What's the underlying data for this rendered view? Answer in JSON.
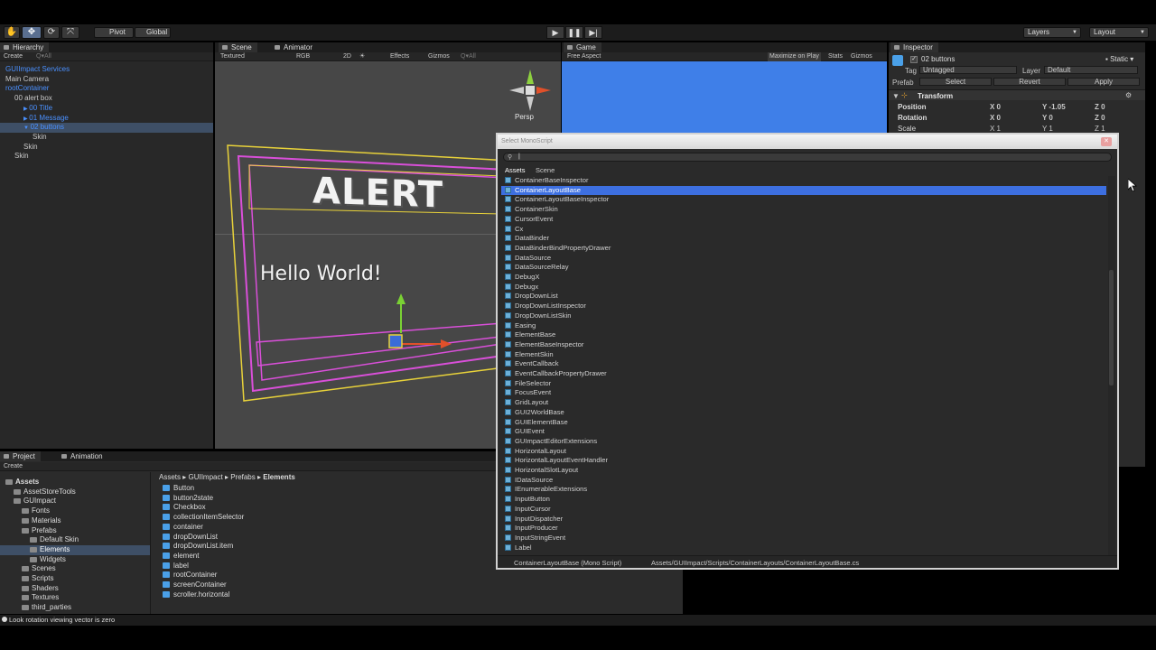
{
  "toolbar": {
    "pivot": "Pivot",
    "global": "Global",
    "layers": "Layers",
    "layout": "Layout"
  },
  "hierarchy": {
    "tab": "Hierarchy",
    "create": "Create",
    "search": "All",
    "items": [
      {
        "label": "GUIImpact Services",
        "indent": 0,
        "color": "blue"
      },
      {
        "label": "Main Camera",
        "indent": 0,
        "color": "normal"
      },
      {
        "label": "rootContainer",
        "indent": 0,
        "color": "blue"
      },
      {
        "label": "00 alert box",
        "indent": 1,
        "color": "normal"
      },
      {
        "label": "00 Title",
        "indent": 2,
        "color": "blue"
      },
      {
        "label": "01 Message",
        "indent": 2,
        "color": "blue"
      },
      {
        "label": "02 buttons",
        "indent": 2,
        "color": "blue",
        "selected": true
      },
      {
        "label": "Skin",
        "indent": 3,
        "color": "normal"
      },
      {
        "label": "Skin",
        "indent": 2,
        "color": "normal"
      },
      {
        "label": "Skin",
        "indent": 1,
        "color": "normal"
      }
    ]
  },
  "scene": {
    "tab": "Scene",
    "tab2": "Animator",
    "shading": "Textured",
    "rgb": "RGB",
    "mode2d": "2D",
    "effects": "Effects",
    "gizmos": "Gizmos",
    "search": "All",
    "persp": "Persp",
    "alert_text": "ALERT",
    "hello_text": "Hello World!"
  },
  "game": {
    "tab": "Game",
    "aspect": "Free Aspect",
    "maximize": "Maximize on Play",
    "stats": "Stats",
    "gizmos": "Gizmos"
  },
  "inspector": {
    "tab": "Inspector",
    "object_name": "02 buttons",
    "static": "Static",
    "tag_label": "Tag",
    "tag_value": "Untagged",
    "layer_label": "Layer",
    "layer_value": "Default",
    "prefab_label": "Prefab",
    "select": "Select",
    "revert": "Revert",
    "apply": "Apply",
    "transform": "Transform",
    "position": "Position",
    "rotation": "Rotation",
    "scale": "Scale",
    "pos_x": "X 0",
    "pos_y": "Y -1.05",
    "pos_z": "Z 0",
    "rot_x": "X 0",
    "rot_y": "Y 0",
    "rot_z": "Z 0",
    "scl_x": "X 1",
    "scl_y": "Y 1",
    "scl_z": "Z 1"
  },
  "project": {
    "tab": "Project",
    "tab2": "Animation",
    "create": "Create",
    "breadcrumb": [
      "Assets",
      "GUIImpact",
      "Prefabs",
      "Elements"
    ],
    "tree": [
      {
        "label": "Assets",
        "indent": 0,
        "bold": true
      },
      {
        "label": "AssetStoreTools",
        "indent": 1
      },
      {
        "label": "GUImpact",
        "indent": 1
      },
      {
        "label": "Fonts",
        "indent": 2
      },
      {
        "label": "Materials",
        "indent": 2
      },
      {
        "label": "Prefabs",
        "indent": 2
      },
      {
        "label": "Default Skin",
        "indent": 3
      },
      {
        "label": "Elements",
        "indent": 3,
        "selected": true
      },
      {
        "label": "Widgets",
        "indent": 3
      },
      {
        "label": "Scenes",
        "indent": 2
      },
      {
        "label": "Scripts",
        "indent": 2
      },
      {
        "label": "Shaders",
        "indent": 2
      },
      {
        "label": "Textures",
        "indent": 2
      },
      {
        "label": "third_parties",
        "indent": 2
      }
    ],
    "files": [
      "Button",
      "button2state",
      "Checkbox",
      "collectionItemSelector",
      "container",
      "dropDownList",
      "dropDownList.item",
      "element",
      "label",
      "rootContainer",
      "screenContainer",
      "scroller.horizontal"
    ]
  },
  "status": {
    "message": "Look rotation viewing vector is zero"
  },
  "dialog": {
    "title": "Select MonoScript",
    "search_value": "|",
    "tab_assets": "Assets",
    "tab_scene": "Scene",
    "items": [
      "ContainerBaseInspector",
      "ContainerLayoutBase",
      "ContainerLayoutBaseInspector",
      "ContainerSkin",
      "CursorEvent",
      "Cx",
      "DataBinder",
      "DataBinderBindPropertyDrawer",
      "DataSource",
      "DataSourceRelay",
      "DebugX",
      "Debugx",
      "DropDownList",
      "DropDownListInspector",
      "DropDownListSkin",
      "Easing",
      "ElementBase",
      "ElementBaseInspector",
      "ElementSkin",
      "EventCallback",
      "EventCallbackPropertyDrawer",
      "FileSelector",
      "FocusEvent",
      "GridLayout",
      "GUI2WorldBase",
      "GUIElementBase",
      "GUIEvent",
      "GUImpactEditorExtensions",
      "HorizontalLayout",
      "HorizontalLayoutEventHandler",
      "HorizontalSlotLayout",
      "IDataSource",
      "IEnumerableExtensions",
      "InputButton",
      "InputCursor",
      "InputDispatcher",
      "InputProducer",
      "InputStringEvent",
      "Label"
    ],
    "selected_index": 1,
    "footer_name": "ContainerLayoutBase (Mono Script)",
    "footer_path": "Assets/GUIImpact/Scripts/ContainerLayouts/ContainerLayoutBase.cs"
  },
  "colors": {
    "selection": "#3d6fe0",
    "game_bg": "#3f7fe8",
    "accent_blue": "#4a90ff"
  }
}
